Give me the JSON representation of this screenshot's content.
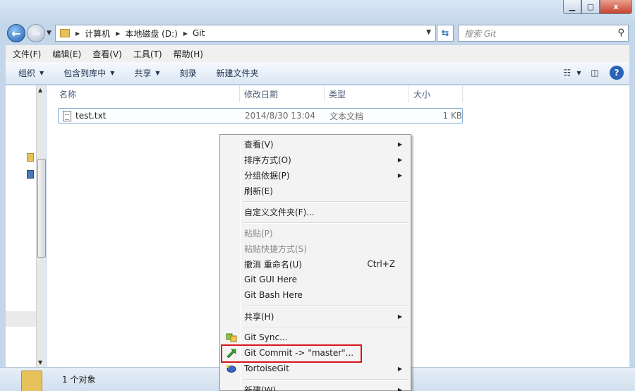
{
  "window": {
    "min_icon": "minimize-icon",
    "max_icon": "maximize-icon",
    "close_label": "x"
  },
  "address": {
    "crumbs": [
      "计算机",
      "本地磁盘 (D:)",
      "Git"
    ]
  },
  "search": {
    "placeholder": "搜索 Git"
  },
  "menubar": [
    "文件(F)",
    "编辑(E)",
    "查看(V)",
    "工具(T)",
    "帮助(H)"
  ],
  "commands": [
    {
      "label": "组织",
      "dropdown": true
    },
    {
      "label": "包含到库中",
      "dropdown": true
    },
    {
      "label": "共享",
      "dropdown": true
    },
    {
      "label": "刻录",
      "dropdown": false
    },
    {
      "label": "新建文件夹",
      "dropdown": false
    }
  ],
  "columns": [
    "名称",
    "修改日期",
    "类型",
    "大小"
  ],
  "files": [
    {
      "name": "test.txt",
      "modified": "2014/8/30 13:04",
      "type": "文本文档",
      "size": "1 KB"
    }
  ],
  "status": {
    "text": "1 个对象"
  },
  "context_menu": [
    {
      "label": "查看(V)",
      "submenu": true
    },
    {
      "label": "排序方式(O)",
      "submenu": true
    },
    {
      "label": "分组依据(P)",
      "submenu": true
    },
    {
      "label": "刷新(E)"
    },
    {
      "label": "自定义文件夹(F)..."
    },
    {
      "label": "粘贴(P)",
      "disabled": true
    },
    {
      "label": "粘贴快捷方式(S)",
      "disabled": true
    },
    {
      "label": "撤消 重命名(U)",
      "shortcut": "Ctrl+Z"
    },
    {
      "label": "Git GUI Here"
    },
    {
      "label": "Git Bash Here"
    },
    {
      "label": "共享(H)",
      "submenu": true
    },
    {
      "label": "Git Sync...",
      "icon": "git-sync-icon"
    },
    {
      "label": "Git Commit -> \"master\"...",
      "icon": "git-commit-icon"
    },
    {
      "label": "TortoiseGit",
      "icon": "tortoisegit-icon",
      "submenu": true
    },
    {
      "label": "新建(W)",
      "submenu": true
    }
  ]
}
